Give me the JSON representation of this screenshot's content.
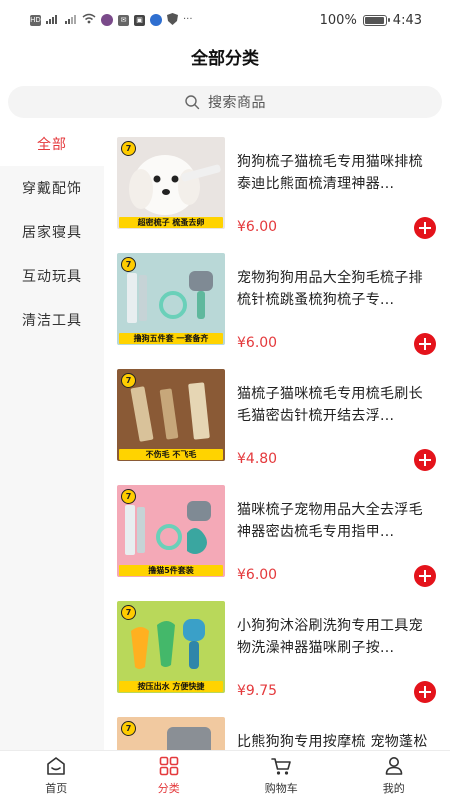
{
  "status_bar": {
    "left_icons": [
      "hd-icon",
      "signal-5g-icon",
      "signal-icon",
      "wifi-icon",
      "app-icon",
      "mail-icon",
      "app-icon",
      "app-icon",
      "shield-icon",
      "more-dots-icon"
    ],
    "battery_text": "100%",
    "battery_level": 1.0,
    "time": "4:43"
  },
  "header": {
    "title": "全部分类"
  },
  "search": {
    "placeholder": "搜索商品"
  },
  "sidebar": {
    "items": [
      {
        "label": "全部",
        "active": true
      },
      {
        "label": "穿戴配饰",
        "active": false
      },
      {
        "label": "居家寝具",
        "active": false
      },
      {
        "label": "互动玩具",
        "active": false
      },
      {
        "label": "清洁工具",
        "active": false
      }
    ]
  },
  "products": [
    {
      "title": "狗狗梳子猫梳毛专用猫咪排梳泰迪比熊面梳清理神器...",
      "price": "¥6.00",
      "banner": "超密梳子 梳蚤去卵",
      "thumb_bg": "#e9e4e1"
    },
    {
      "title": "宠物狗狗用品大全狗毛梳子排梳针梳跳蚤梳狗梳子专...",
      "price": "¥6.00",
      "banner": "撸狗五件套 一套备齐",
      "thumb_bg": "#b9d8d7"
    },
    {
      "title": "猫梳子猫咪梳毛专用梳毛刷长毛猫密齿针梳开结去浮...",
      "price": "¥4.80",
      "banner": "不伤毛 不飞毛",
      "thumb_bg": "#8a5a36"
    },
    {
      "title": "猫咪梳子宠物用品大全去浮毛神器密齿梳毛专用指甲...",
      "price": "¥6.00",
      "banner": "撸猫5件套装",
      "thumb_bg": "#f4a9b7"
    },
    {
      "title": "小狗狗沐浴刷洗狗专用工具宠物洗澡神器猫咪刷子按...",
      "price": "¥9.75",
      "banner": "按压出水 方便快捷",
      "thumb_bg": "#b9d85a"
    },
    {
      "title": "比熊狗狗专用按摩梳 宠物蓬松洗澡神器 小型犬泰迪梳...",
      "price": "",
      "banner": "",
      "thumb_bg": "#f1c9a0"
    }
  ],
  "tab_bar": {
    "tabs": [
      {
        "label": "首页",
        "icon": "home-icon",
        "active": false
      },
      {
        "label": "分类",
        "icon": "category-grid-icon",
        "active": true
      },
      {
        "label": "购物车",
        "icon": "cart-icon",
        "active": false
      },
      {
        "label": "我的",
        "icon": "user-icon",
        "active": false
      }
    ]
  },
  "colors": {
    "accent": "#e4393c",
    "add_button": "#e4131b"
  }
}
